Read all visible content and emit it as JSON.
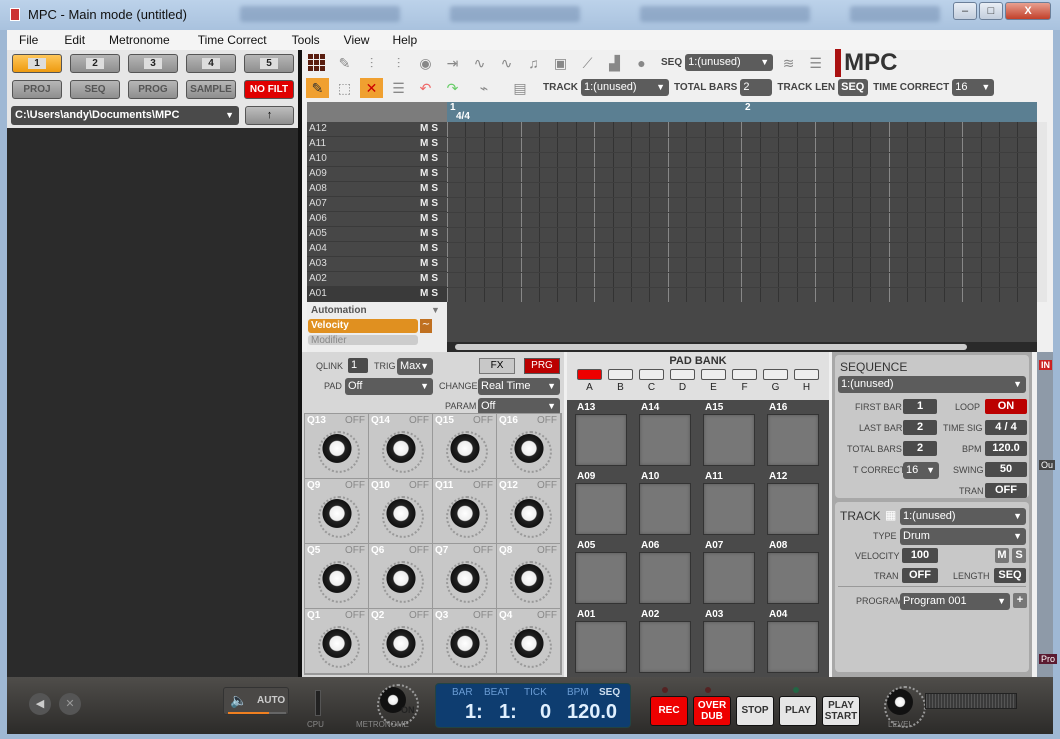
{
  "window": {
    "title": "MPC - Main mode (untitled)",
    "minimize": "–",
    "maximize": "□",
    "close": "X"
  },
  "menu": [
    "File",
    "Edit",
    "Metronome",
    "Time Correct",
    "Tools",
    "View",
    "Help"
  ],
  "left": {
    "tabs": [
      "1",
      "2",
      "3",
      "4",
      "5"
    ],
    "active_tab": "1",
    "browser_buttons": [
      "PROJ",
      "SEQ",
      "PROG",
      "SAMPLE"
    ],
    "filter_button": "NO FILT",
    "path": "C:\\Users\\andy\\Documents\\MPC",
    "up_icon": "↑"
  },
  "toolbar": {
    "seq_label": "SEQ",
    "seq_value": "1:(unused)",
    "logo": "MPC",
    "track_label": "TRACK",
    "track_value": "1:(unused)",
    "total_bars_label": "TOTAL BARS",
    "total_bars_value": "2",
    "track_len_label": "TRACK LEN",
    "track_len_value": "SEQ",
    "time_correct_label": "TIME CORRECT",
    "time_correct_value": "16"
  },
  "grid": {
    "bar_markers": [
      "1",
      "2"
    ],
    "time_sig": "4/4",
    "tracks": [
      "A12",
      "A11",
      "A10",
      "A09",
      "A08",
      "A07",
      "A06",
      "A05",
      "A04",
      "A03",
      "A02",
      "A01"
    ],
    "mute": "M",
    "solo": "S",
    "automation_label": "Automation",
    "automation_items": [
      "Velocity",
      "Modifier"
    ]
  },
  "qlink": {
    "qlink_label": "QLINK",
    "qlink_value": "1",
    "trig_label": "TRIG",
    "trig_value": "Max",
    "fx": "FX",
    "prg": "PRG",
    "pad_label": "PAD",
    "pad_value": "Off",
    "change_label": "CHANGE",
    "change_value": "Real Time",
    "param_label": "PARAM",
    "param_value": "Off",
    "knobs": [
      {
        "n": "Q13",
        "v": "OFF"
      },
      {
        "n": "Q14",
        "v": "OFF"
      },
      {
        "n": "Q15",
        "v": "OFF"
      },
      {
        "n": "Q16",
        "v": "OFF"
      },
      {
        "n": "Q9",
        "v": "OFF"
      },
      {
        "n": "Q10",
        "v": "OFF"
      },
      {
        "n": "Q11",
        "v": "OFF"
      },
      {
        "n": "Q12",
        "v": "OFF"
      },
      {
        "n": "Q5",
        "v": "OFF"
      },
      {
        "n": "Q6",
        "v": "OFF"
      },
      {
        "n": "Q7",
        "v": "OFF"
      },
      {
        "n": "Q8",
        "v": "OFF"
      },
      {
        "n": "Q1",
        "v": "OFF"
      },
      {
        "n": "Q2",
        "v": "OFF"
      },
      {
        "n": "Q3",
        "v": "OFF"
      },
      {
        "n": "Q4",
        "v": "OFF"
      }
    ]
  },
  "padbank": {
    "title": "PAD BANK",
    "banks": [
      "A",
      "B",
      "C",
      "D",
      "E",
      "F",
      "G",
      "H"
    ],
    "active_bank": "A",
    "pads": [
      "A13",
      "A14",
      "A15",
      "A16",
      "A09",
      "A10",
      "A11",
      "A12",
      "A05",
      "A06",
      "A07",
      "A08",
      "A01",
      "A02",
      "A03",
      "A04"
    ]
  },
  "sequence": {
    "title": "SEQUENCE",
    "value": "1:(unused)",
    "first_bar_label": "FIRST BAR",
    "first_bar": "1",
    "loop_label": "LOOP",
    "loop": "ON",
    "last_bar_label": "LAST BAR",
    "last_bar": "2",
    "time_sig_label": "TIME SIG",
    "time_sig": "4 / 4",
    "total_bars_label": "TOTAL BARS",
    "total_bars": "2",
    "bpm_label": "BPM",
    "bpm": "120.0",
    "tcorrect_label": "T CORRECT",
    "tcorrect": "16",
    "swing_label": "SWING",
    "swing": "50",
    "tran_label": "TRAN",
    "tran": "OFF"
  },
  "track": {
    "title": "TRACK",
    "value": "1:(unused)",
    "type_label": "TYPE",
    "type": "Drum",
    "velocity_label": "VELOCITY",
    "velocity": "100",
    "m": "M",
    "s": "S",
    "tran_label": "TRAN",
    "tran": "OFF",
    "length_label": "LENGTH",
    "length": "SEQ",
    "program_label": "PROGRAM",
    "program": "Program 001",
    "add": "+"
  },
  "side": {
    "in": "IN",
    "in2": "IN",
    "out": "Ou",
    "pro": "Pro"
  },
  "transport": {
    "auto": "AUTO",
    "cpu": "CPU",
    "metronome": "METRONOME",
    "metro_on": "ON",
    "bar_label": "BAR",
    "beat_label": "BEAT",
    "tick_label": "TICK",
    "bpm_label": "BPM",
    "seq_label": "SEQ",
    "bar": "1:",
    "beat": "1:",
    "tick": "0",
    "bpm": "120.0",
    "rec": "REC",
    "overdub1": "OVER",
    "overdub2": "DUB",
    "stop": "STOP",
    "play": "PLAY",
    "playstart1": "PLAY",
    "playstart2": "START",
    "level": "LEVEL",
    "volume_level": 0.7
  }
}
